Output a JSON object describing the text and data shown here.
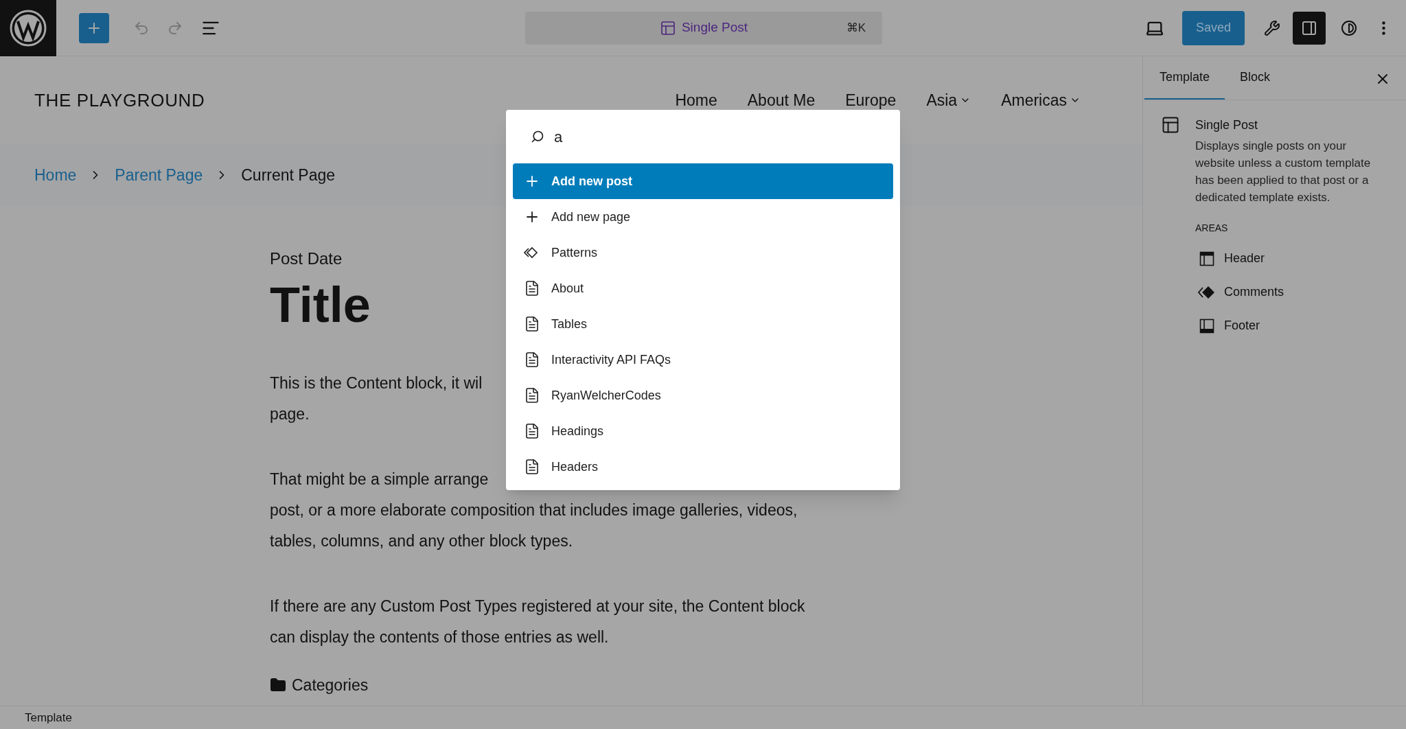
{
  "toolbar": {
    "command_bar": {
      "label": "Single Post",
      "shortcut": "⌘K"
    },
    "save_button": "Saved"
  },
  "site": {
    "title": "THE PLAYGROUND",
    "nav": [
      {
        "label": "Home",
        "has_submenu": false
      },
      {
        "label": "About Me",
        "has_submenu": false
      },
      {
        "label": "Europe",
        "has_submenu": false
      },
      {
        "label": "Asia",
        "has_submenu": true
      },
      {
        "label": "Americas",
        "has_submenu": true
      }
    ]
  },
  "breadcrumb": [
    {
      "label": "Home",
      "kind": "link"
    },
    {
      "label": "Parent Page",
      "kind": "link"
    },
    {
      "label": "Current Page",
      "kind": "current"
    }
  ],
  "post": {
    "date": "Post Date",
    "title": "Title",
    "paragraphs": [
      {
        "lines": [
          "This is the Content block, it wil",
          "page."
        ]
      },
      {
        "lines": [
          "That might be a simple arrange",
          "post, or a more elaborate composition that includes image galleries, videos,",
          "tables, columns, and any other block types."
        ]
      },
      {
        "lines": [
          "If there are any Custom Post Types registered at your site, the Content block",
          "can display the contents of those entries as well."
        ]
      }
    ],
    "categories": "Categories"
  },
  "command_palette": {
    "query": "a",
    "results": [
      {
        "label": "Add new post",
        "kind": "add",
        "selected": true
      },
      {
        "label": "Add new page",
        "kind": "add",
        "selected": false
      },
      {
        "label": "Patterns",
        "kind": "pattern",
        "selected": false
      },
      {
        "label": "About",
        "kind": "page",
        "selected": false
      },
      {
        "label": "Tables",
        "kind": "page",
        "selected": false
      },
      {
        "label": "Interactivity API FAQs",
        "kind": "page",
        "selected": false
      },
      {
        "label": "RyanWelcherCodes",
        "kind": "page",
        "selected": false
      },
      {
        "label": "Headings",
        "kind": "page",
        "selected": false
      },
      {
        "label": "Headers",
        "kind": "page",
        "selected": false
      }
    ]
  },
  "sidebar": {
    "tabs": [
      {
        "label": "Template",
        "selected": true
      },
      {
        "label": "Block",
        "selected": false
      }
    ],
    "template": {
      "title": "Single Post",
      "description": "Displays single posts on your website unless a custom template has been applied to that post or a dedicated template exists."
    },
    "areas_heading": "AREAS",
    "areas": [
      {
        "label": "Header",
        "kind": "header"
      },
      {
        "label": "Comments",
        "kind": "comments"
      },
      {
        "label": "Footer",
        "kind": "footer"
      }
    ]
  },
  "status_bar": "Template"
}
